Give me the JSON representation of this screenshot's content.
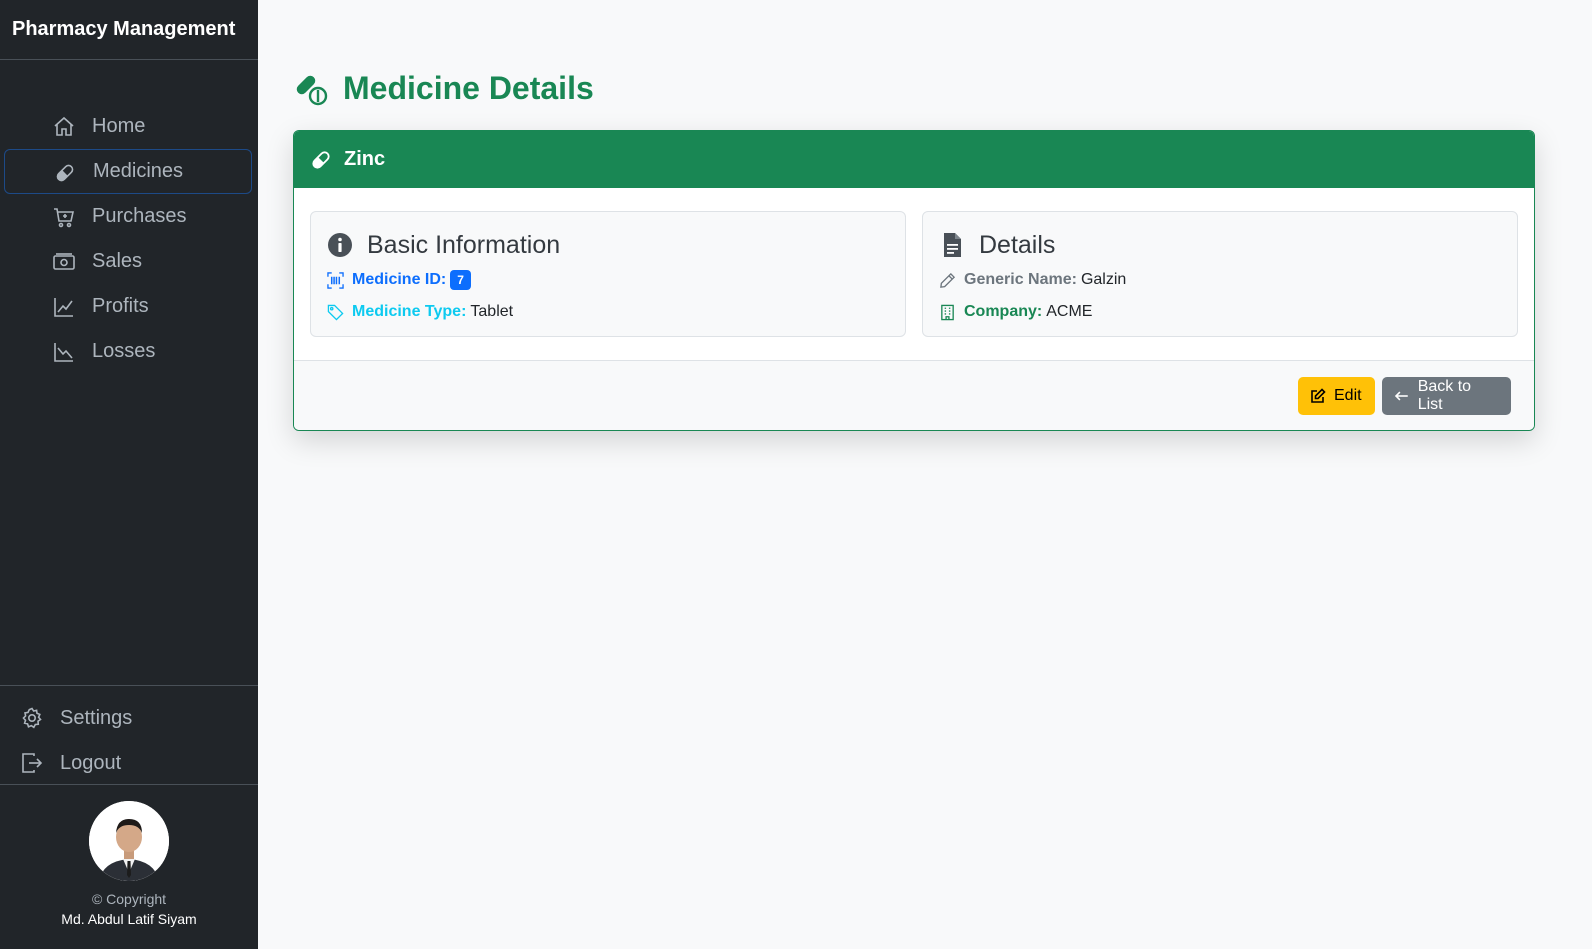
{
  "app": {
    "brand": "Pharmacy Management"
  },
  "sidebar": {
    "items": [
      {
        "label": "Home",
        "icon": "home-icon"
      },
      {
        "label": "Medicines",
        "icon": "capsule-icon",
        "active": true
      },
      {
        "label": "Purchases",
        "icon": "cart-icon"
      },
      {
        "label": "Sales",
        "icon": "cash-icon"
      },
      {
        "label": "Profits",
        "icon": "graph-up-icon"
      },
      {
        "label": "Losses",
        "icon": "graph-down-icon"
      }
    ],
    "bottom": [
      {
        "label": "Settings",
        "icon": "gear-icon"
      },
      {
        "label": "Logout",
        "icon": "logout-icon"
      }
    ],
    "copyright": "© Copyright",
    "author": "Md. Abdul Latif Siyam"
  },
  "page": {
    "title": "Medicine Details"
  },
  "card": {
    "header": "Zinc",
    "basic": {
      "title": "Basic Information",
      "id_label": "Medicine ID:",
      "id_value": "7",
      "type_label": "Medicine Type:",
      "type_value": "Tablet"
    },
    "details": {
      "title": "Details",
      "generic_label": "Generic Name:",
      "generic_value": "Galzin",
      "company_label": "Company:",
      "company_value": "ACME"
    },
    "buttons": {
      "edit": "Edit",
      "back": "Back to List"
    }
  },
  "colors": {
    "sidebar_bg": "#212529",
    "primary_green": "#198754",
    "id_blue": "#0d6efd",
    "type_cyan": "#0dcaf0",
    "edit_yellow": "#ffc107",
    "back_gray": "#6c757d"
  }
}
